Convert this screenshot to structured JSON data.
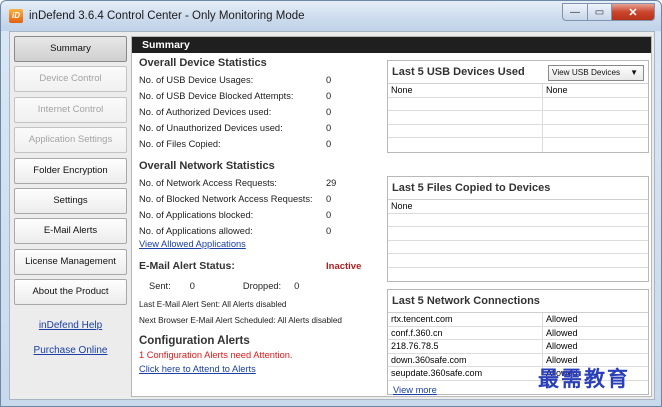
{
  "window": {
    "icon_text": "iD",
    "title": "inDefend 3.6.4 Control Center - Only Monitoring Mode",
    "minimize": "—",
    "maximize": "▭",
    "close": "✕"
  },
  "sidebar": {
    "buttons": [
      {
        "label": "Summary",
        "state": "active"
      },
      {
        "label": "Device Control",
        "state": "disabled"
      },
      {
        "label": "Internet Control",
        "state": "disabled"
      },
      {
        "label": "Application Settings",
        "state": "disabled"
      },
      {
        "label": "Folder Encryption",
        "state": "enabled"
      },
      {
        "label": "Settings",
        "state": "enabled"
      },
      {
        "label": "E-Mail Alerts",
        "state": "enabled"
      },
      {
        "label": "License Management",
        "state": "enabled"
      },
      {
        "label": "About the Product",
        "state": "enabled"
      }
    ],
    "links": [
      "inDefend Help",
      "Purchase Online"
    ]
  },
  "summary": {
    "header": "Summary",
    "device_stats": {
      "title": "Overall Device Statistics",
      "rows": [
        {
          "label": "No. of USB Device Usages:",
          "value": "0"
        },
        {
          "label": "No. of USB Device Blocked Attempts:",
          "value": "0"
        },
        {
          "label": "No. of Authorized Devices used:",
          "value": "0"
        },
        {
          "label": "No. of Unauthorized Devices used:",
          "value": "0"
        },
        {
          "label": "No. of Files Copied:",
          "value": "0"
        }
      ]
    },
    "network_stats": {
      "title": "Overall Network Statistics",
      "rows": [
        {
          "label": "No. of Network Access Requests:",
          "value": "29"
        },
        {
          "label": "No. of Blocked Network Access Requests:",
          "value": "0"
        },
        {
          "label": "No. of Applications blocked:",
          "value": "0"
        },
        {
          "label": "No. of Applications allowed:",
          "value": "0"
        }
      ],
      "link": "View Allowed Applications"
    },
    "email_alert": {
      "title": "E-Mail Alert Status:",
      "status": "Inactive",
      "sent_label": "Sent:",
      "sent_value": "0",
      "dropped_label": "Dropped:",
      "dropped_value": "0",
      "last_sent": "Last E-Mail Alert Sent: All Alerts disabled",
      "next_scheduled": "Next Browser E-Mail Alert Scheduled: All Alerts disabled"
    },
    "config_alerts": {
      "title": "Configuration Alerts",
      "message": "1 Configuration Alerts need Attention.",
      "link": "Click here to Attend to Alerts"
    }
  },
  "usb_box": {
    "title": "Last 5 USB Devices Used",
    "dropdown": "View USB Devices",
    "rows": [
      {
        "c1": "None",
        "c2": "None"
      },
      {
        "c1": "",
        "c2": ""
      },
      {
        "c1": "",
        "c2": ""
      },
      {
        "c1": "",
        "c2": ""
      },
      {
        "c1": "",
        "c2": ""
      }
    ]
  },
  "files_box": {
    "title": "Last 5 Files Copied to Devices",
    "rows": [
      "None",
      "",
      "",
      "",
      "",
      ""
    ]
  },
  "network_box": {
    "title": "Last 5 Network Connections",
    "rows": [
      {
        "c1": "rtx.tencent.com",
        "c2": "Allowed"
      },
      {
        "c1": "conf.f.360.cn",
        "c2": "Allowed"
      },
      {
        "c1": "218.76.78.5",
        "c2": "Allowed"
      },
      {
        "c1": "down.360safe.com",
        "c2": "Allowed"
      },
      {
        "c1": "seupdate.360safe.com",
        "c2": "Allowed"
      }
    ],
    "link": "View more"
  },
  "watermark": "最需教育"
}
